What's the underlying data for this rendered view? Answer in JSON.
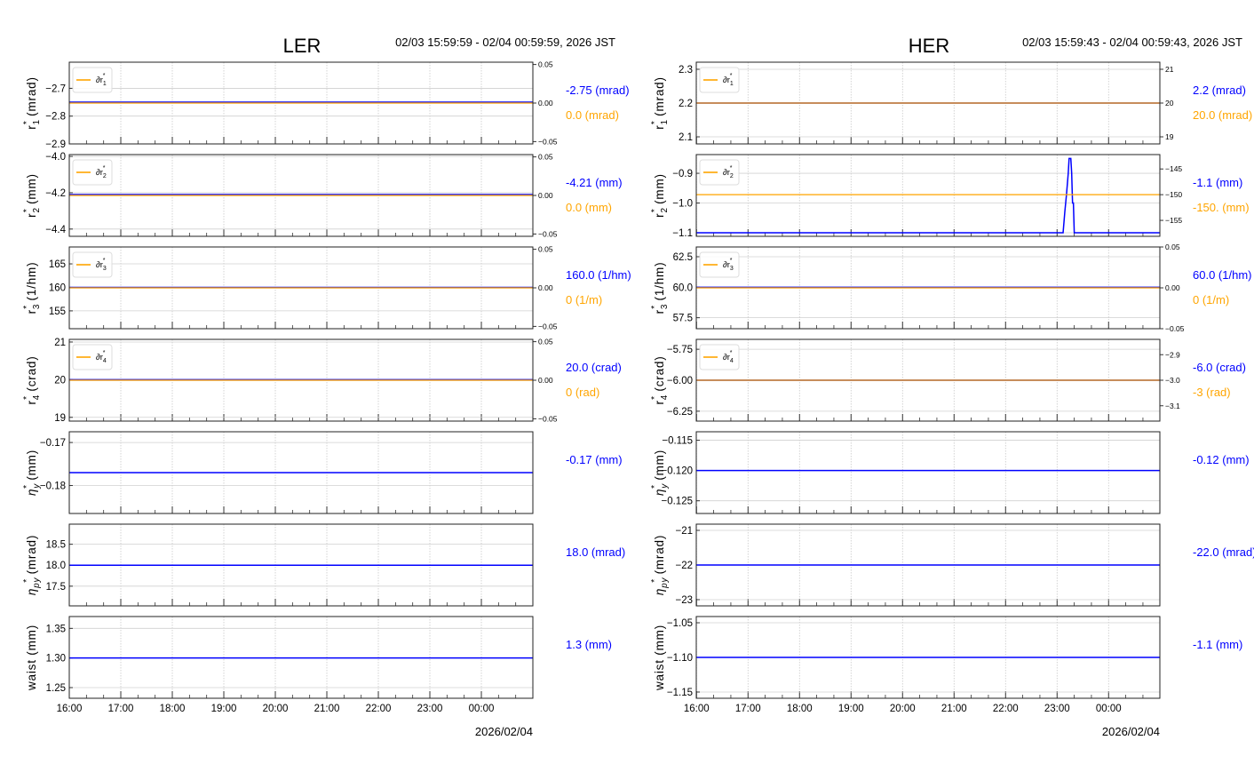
{
  "chart_data": [
    {
      "type": "line",
      "title": "LER",
      "time_range": "02/03 15:59:59 - 02/04 00:59:59, 2026 JST",
      "date_label": "2026/02/04",
      "xticks": [
        "16:00",
        "17:00",
        "18:00",
        "19:00",
        "20:00",
        "21:00",
        "22:00",
        "23:00",
        "00:00"
      ],
      "xlim": [
        "15:59:59",
        "00:59:59"
      ],
      "grid": true,
      "panels": [
        {
          "ylabel": {
            "symbol": "r",
            "sub": "1",
            "unit": "(mrad)"
          },
          "yticks": [
            "−2.7",
            "−2.8",
            "−2.9"
          ],
          "ylim": [
            -2.9,
            -2.606
          ],
          "series": [
            {
              "color": "#0000ff",
              "points": [
                [
                  "15:59:59",
                  -2.75
                ],
                [
                  "00:59:59",
                  -2.75
                ]
              ]
            }
          ],
          "right_axis": {
            "yticks": [
              "0.05",
              "0.00",
              "−0.05"
            ],
            "ylim": [
              -0.053,
              0.053
            ],
            "series": [
              {
                "name": "∂r1*",
                "color": "#ffa500",
                "points": [
                  [
                    "15:59:59",
                    0.0
                  ],
                  [
                    "00:59:59",
                    0.0
                  ]
                ]
              }
            ]
          },
          "legend": {
            "symbol": "∂r",
            "sub": "1"
          },
          "value_label": "-2.75 (mrad)",
          "offset_label": "0.0 (mrad)"
        },
        {
          "ylabel": {
            "symbol": "r",
            "sub": "2",
            "unit": "(mm)"
          },
          "yticks": [
            "−4.0",
            "−4.2",
            "−4.4"
          ],
          "ylim": [
            -4.44,
            -3.99
          ],
          "series": [
            {
              "color": "#0000ff",
              "points": [
                [
                  "15:59:59",
                  -4.21
                ],
                [
                  "00:59:59",
                  -4.21
                ]
              ]
            }
          ],
          "right_axis": {
            "yticks": [
              "0.05",
              "0.00",
              "−0.05"
            ],
            "ylim": [
              -0.053,
              0.053
            ],
            "series": [
              {
                "name": "∂r2*",
                "color": "#ffa500",
                "points": [
                  [
                    "15:59:59",
                    0.0
                  ],
                  [
                    "00:59:59",
                    0.0
                  ]
                ]
              }
            ]
          },
          "legend": {
            "symbol": "∂r",
            "sub": "2"
          },
          "value_label": "-4.21 (mm)",
          "offset_label": "0.0 (mm)"
        },
        {
          "ylabel": {
            "symbol": "r",
            "sub": "3",
            "unit": "(1/hm)"
          },
          "yticks": [
            "165",
            "160",
            "155"
          ],
          "ylim": [
            151.2,
            168.6
          ],
          "series": [
            {
              "color": "#0000ff",
              "points": [
                [
                  "15:59:59",
                  160.0
                ],
                [
                  "00:59:59",
                  160.0
                ]
              ]
            }
          ],
          "right_axis": {
            "yticks": [
              "0.05",
              "0.00",
              "−0.05"
            ],
            "ylim": [
              -0.053,
              0.053
            ],
            "series": [
              {
                "name": "∂r3*",
                "color": "#ffa500",
                "points": [
                  [
                    "15:59:59",
                    0.0
                  ],
                  [
                    "00:59:59",
                    0.0
                  ]
                ]
              }
            ]
          },
          "legend": {
            "symbol": "∂r",
            "sub": "3"
          },
          "value_label": "160.0 (1/hm)",
          "offset_label": "0 (1/m)"
        },
        {
          "ylabel": {
            "symbol": "r",
            "sub": "4",
            "unit": "(crad)"
          },
          "yticks": [
            "21",
            "20",
            "19"
          ],
          "ylim": [
            18.9,
            21.07
          ],
          "series": [
            {
              "color": "#0000ff",
              "points": [
                [
                  "15:59:59",
                  20.0
                ],
                [
                  "00:59:59",
                  20.0
                ]
              ]
            }
          ],
          "right_axis": {
            "yticks": [
              "0.05",
              "0.00",
              "−0.05"
            ],
            "ylim": [
              -0.053,
              0.053
            ],
            "series": [
              {
                "name": "∂r4*",
                "color": "#ffa500",
                "points": [
                  [
                    "15:59:59",
                    0.0
                  ],
                  [
                    "00:59:59",
                    0.0
                  ]
                ]
              }
            ]
          },
          "legend": {
            "symbol": "∂r",
            "sub": "4"
          },
          "value_label": "20.0 (crad)",
          "offset_label": "0 (rad)"
        },
        {
          "ylabel": {
            "symbol": "η",
            "sub": "y",
            "unit": "(mm)",
            "italic": true
          },
          "yticks": [
            "−0.17",
            "−0.18"
          ],
          "ylim": [
            -0.1865,
            -0.1675
          ],
          "series": [
            {
              "color": "#0000ff",
              "points": [
                [
                  "15:59:59",
                  -0.177
                ],
                [
                  "00:59:59",
                  -0.177
                ]
              ]
            }
          ],
          "value_label": "-0.17 (mm)"
        },
        {
          "ylabel": {
            "symbol": "η",
            "sub": "py",
            "unit": "(mrad)",
            "italic": true
          },
          "yticks": [
            "18.5",
            "18.0",
            "17.5"
          ],
          "ylim": [
            17.03,
            18.98
          ],
          "series": [
            {
              "color": "#0000ff",
              "points": [
                [
                  "15:59:59",
                  18.0
                ],
                [
                  "00:59:59",
                  18.0
                ]
              ]
            }
          ],
          "value_label": "18.0 (mrad)"
        },
        {
          "ylabel": {
            "symbol": "waist",
            "sub": "",
            "unit": "(mm)",
            "nostar": true
          },
          "yticks": [
            "1.35",
            "1.30",
            "1.25"
          ],
          "ylim": [
            1.232,
            1.37
          ],
          "series": [
            {
              "color": "#0000ff",
              "points": [
                [
                  "15:59:59",
                  1.3
                ],
                [
                  "00:59:59",
                  1.3
                ]
              ]
            }
          ],
          "value_label": "1.3 (mm)"
        }
      ]
    },
    {
      "type": "line",
      "title": "HER",
      "time_range": "02/03 15:59:43 - 02/04 00:59:43, 2026 JST",
      "date_label": "2026/02/04",
      "xticks": [
        "16:00",
        "17:00",
        "18:00",
        "19:00",
        "20:00",
        "21:00",
        "22:00",
        "23:00",
        "00:00"
      ],
      "xlim": [
        "15:59:43",
        "00:59:43"
      ],
      "grid": true,
      "panels": [
        {
          "ylabel": {
            "symbol": "r",
            "sub": "1",
            "unit": "(mrad)"
          },
          "yticks": [
            "2.3",
            "2.2",
            "2.1"
          ],
          "ylim": [
            2.079,
            2.321
          ],
          "series": [
            {
              "color": "#0000ff",
              "points": [
                [
                  "15:59:43",
                  2.2
                ],
                [
                  "00:59:43",
                  2.2
                ]
              ]
            }
          ],
          "right_axis": {
            "yticks": [
              "21",
              "20",
              "19"
            ],
            "ylim": [
              18.79,
              21.21
            ],
            "series": [
              {
                "name": "∂r1*",
                "color": "#ffa500",
                "points": [
                  [
                    "15:59:43",
                    20.0
                  ],
                  [
                    "00:59:43",
                    20.0
                  ]
                ]
              }
            ]
          },
          "legend": {
            "symbol": "∂r",
            "sub": "1"
          },
          "value_label": "2.2 (mrad)",
          "offset_label": "20.0 (mrad)"
        },
        {
          "ylabel": {
            "symbol": "r",
            "sub": "2",
            "unit": "(mm)"
          },
          "yticks": [
            "−0.9",
            "−1.0",
            "−1.1"
          ],
          "ylim": [
            -1.112,
            -0.837
          ],
          "series": [
            {
              "color": "#0000ff",
              "points": [
                [
                  "15:59:43",
                  -1.1
                ],
                [
                  "23:07",
                  -1.1
                ],
                [
                  "23:09",
                  -1.03
                ],
                [
                  "23:11",
                  -0.97
                ],
                [
                  "23:13",
                  -0.9
                ],
                [
                  "23:14",
                  -0.85
                ],
                [
                  "23:16",
                  -0.85
                ],
                [
                  "23:17",
                  -0.9
                ],
                [
                  "23:18",
                  -1.0
                ],
                [
                  "23:19",
                  -1.0
                ],
                [
                  "23:20",
                  -1.1
                ],
                [
                  "00:59:43",
                  -1.1
                ]
              ]
            }
          ],
          "right_axis": {
            "yticks": [
              "−145",
              "−150",
              "−155"
            ],
            "ylim": [
              -158.1,
              -142.2
            ],
            "series": [
              {
                "name": "∂r2*",
                "color": "#ffa500",
                "points": [
                  [
                    "15:59:43",
                    -150.0
                  ],
                  [
                    "00:59:43",
                    -150.0
                  ]
                ]
              }
            ]
          },
          "legend": {
            "symbol": "∂r",
            "sub": "2"
          },
          "value_label": "-1.1 (mm)",
          "offset_label": "-150. (mm)"
        },
        {
          "ylabel": {
            "symbol": "r",
            "sub": "3",
            "unit": "(1/hm)"
          },
          "yticks": [
            "62.5",
            "60.0",
            "57.5"
          ],
          "ylim": [
            56.6,
            63.3
          ],
          "series": [
            {
              "color": "#0000ff",
              "points": [
                [
                  "15:59:43",
                  60.0
                ],
                [
                  "00:59:43",
                  60.0
                ]
              ]
            }
          ],
          "right_axis": {
            "yticks": [
              "0.05",
              "0.00",
              "−0.05"
            ],
            "ylim": [
              -0.05,
              0.05
            ],
            "series": [
              {
                "name": "∂r3*",
                "color": "#ffa500",
                "points": [
                  [
                    "15:59:43",
                    0.0
                  ],
                  [
                    "00:59:43",
                    0.0
                  ]
                ]
              }
            ]
          },
          "legend": {
            "symbol": "∂r",
            "sub": "3"
          },
          "value_label": "60.0 (1/hm)",
          "offset_label": "0 (1/m)"
        },
        {
          "ylabel": {
            "symbol": "r",
            "sub": "4",
            "unit": "(crad)"
          },
          "yticks": [
            "−5.75",
            "−6.00",
            "−6.25"
          ],
          "ylim": [
            -6.33,
            -5.67
          ],
          "series": [
            {
              "color": "#0000ff",
              "points": [
                [
                  "15:59:43",
                  -6.0
                ],
                [
                  "00:59:43",
                  -6.0
                ]
              ]
            }
          ],
          "right_axis": {
            "yticks": [
              "−2.9",
              "−3.0",
              "−3.1"
            ],
            "ylim": [
              -3.16,
              -2.84
            ],
            "series": [
              {
                "name": "∂r4*",
                "color": "#ffa500",
                "points": [
                  [
                    "15:59:43",
                    -3.0
                  ],
                  [
                    "00:59:43",
                    -3.0
                  ]
                ]
              }
            ]
          },
          "legend": {
            "symbol": "∂r",
            "sub": "4"
          },
          "value_label": "-6.0 (crad)",
          "offset_label": "-3 (rad)"
        },
        {
          "ylabel": {
            "symbol": "η",
            "sub": "y",
            "unit": "(mm)",
            "italic": true
          },
          "yticks": [
            "−0.115",
            "−0.120",
            "−0.125"
          ],
          "ylim": [
            -0.1271,
            -0.1136
          ],
          "series": [
            {
              "color": "#0000ff",
              "points": [
                [
                  "15:59:43",
                  -0.12
                ],
                [
                  "00:59:43",
                  -0.12
                ]
              ]
            }
          ],
          "value_label": "-0.12 (mm)"
        },
        {
          "ylabel": {
            "symbol": "η",
            "sub": "py",
            "unit": "(mrad)",
            "italic": true
          },
          "yticks": [
            "−21",
            "−22",
            "−23"
          ],
          "ylim": [
            -23.18,
            -20.82
          ],
          "series": [
            {
              "color": "#0000ff",
              "points": [
                [
                  "15:59:43",
                  -22.0
                ],
                [
                  "00:59:43",
                  -22.0
                ]
              ]
            }
          ],
          "value_label": "-22.0 (mrad)"
        },
        {
          "ylabel": {
            "symbol": "waist",
            "sub": "",
            "unit": "(mm)",
            "nostar": true
          },
          "yticks": [
            "−1.05",
            "−1.10",
            "−1.15"
          ],
          "ylim": [
            -1.159,
            -1.041
          ],
          "series": [
            {
              "color": "#0000ff",
              "points": [
                [
                  "15:59:43",
                  -1.1
                ],
                [
                  "00:59:43",
                  -1.1
                ]
              ]
            }
          ],
          "value_label": "-1.1 (mm)"
        }
      ]
    }
  ],
  "colors": {
    "main": "#0000ff",
    "offset": "#ffa500"
  }
}
